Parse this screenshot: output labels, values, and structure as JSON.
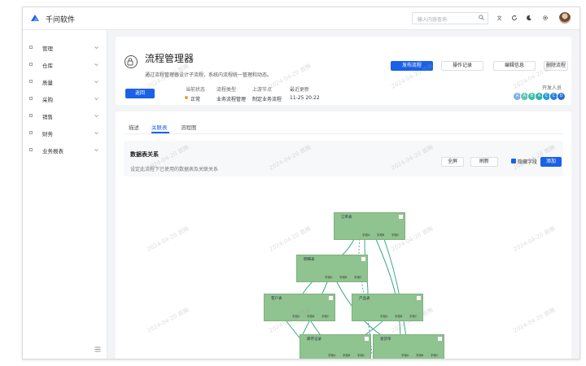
{
  "app": {
    "title": "千问软件"
  },
  "topbar": {
    "search_placeholder": "输入内容查询"
  },
  "sidebar": {
    "items": [
      {
        "label": "管理"
      },
      {
        "label": "仓库"
      },
      {
        "label": "质量"
      },
      {
        "label": "采购"
      },
      {
        "label": "销售"
      },
      {
        "label": "财务"
      },
      {
        "label": "业务报表"
      }
    ]
  },
  "header": {
    "title": "流程管理器",
    "description": "通过流程管理器设计子流程，系统内流程统一管理和动态。",
    "back_label": "返回",
    "actions": [
      {
        "label": "发布流程"
      },
      {
        "label": "操作记录"
      },
      {
        "label": "编辑信息"
      },
      {
        "label": "删除流程"
      }
    ],
    "meta": [
      {
        "key": "当前状态",
        "value": "正常"
      },
      {
        "key": "流程类型",
        "value": "业务流程管理"
      },
      {
        "key": "上游节点",
        "value": "制定业务流程"
      },
      {
        "key": "最近更新",
        "value": "11-25 20:22"
      }
    ],
    "devs_label": "开发人员",
    "devs": [
      {
        "initial": "A",
        "color": "#7fb0e8"
      },
      {
        "initial": "A",
        "color": "#5ec6b3"
      },
      {
        "initial": "B",
        "color": "#3fbfa5"
      },
      {
        "initial": "A",
        "color": "#2fb3a8"
      },
      {
        "initial": "C",
        "color": "#2a9fd8"
      },
      {
        "initial": "C",
        "color": "#2b7fe0"
      },
      {
        "initial": "D",
        "color": "#2d6cdf"
      }
    ]
  },
  "tabs": [
    {
      "label": "描述"
    },
    {
      "label": "关联表"
    },
    {
      "label": "流程图"
    }
  ],
  "panel": {
    "title": "数据表关系",
    "description": "设定此流程下已使用的数据表及关联关系",
    "buttons": [
      {
        "label": "全屏"
      },
      {
        "label": "刷新"
      },
      {
        "label": "添加"
      }
    ],
    "checkbox_label": "隐藏字段"
  },
  "graph": {
    "nodes": [
      {
        "title": "订单表",
        "ports": [
          "字段A",
          "字段B",
          "字段C"
        ]
      },
      {
        "title": "明细表",
        "ports": [
          "字段A",
          "字段B",
          "字段C"
        ]
      },
      {
        "title": "客户表",
        "ports": [
          "字段A",
          "字段B",
          "字段C"
        ]
      },
      {
        "title": "产品表",
        "ports": [
          "字段A",
          "字段B",
          "字段C"
        ]
      },
      {
        "title": "库存记录",
        "ports": [
          "字段A",
          "字段B",
          "字段C"
        ]
      },
      {
        "title": "发货单",
        "ports": [
          "字段A",
          "字段B",
          "字段C"
        ]
      }
    ]
  },
  "watermark": "2024-04-20 首腾",
  "colors": {
    "primary": "#1a61e8",
    "node": "#8fc38f",
    "edge": "#3aa98a"
  }
}
